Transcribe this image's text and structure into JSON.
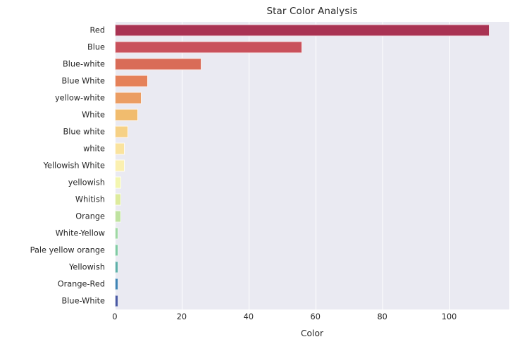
{
  "chart_data": {
    "type": "bar",
    "orientation": "horizontal",
    "title": "Star Color Analysis",
    "xlabel": "Color",
    "ylabel": "",
    "categories": [
      "Red",
      "Blue",
      "Blue-white",
      "Blue White",
      "yellow-white",
      "White",
      "Blue white",
      "white",
      "Yellowish White",
      "yellowish",
      "Whitish",
      "Orange",
      "White-Yellow",
      "Pale yellow orange",
      "Yellowish",
      "Orange-Red",
      "Blue-White"
    ],
    "values": [
      112,
      56,
      26,
      10,
      8,
      7,
      4,
      3,
      3,
      2,
      2,
      2,
      1,
      1,
      1,
      1,
      1
    ],
    "bar_colors": [
      "#a93353",
      "#c9515c",
      "#d96c58",
      "#e58159",
      "#eb9d63",
      "#f1bc6e",
      "#f6d186",
      "#fae39e",
      "#fbf0b0",
      "#f3f6b0",
      "#ddeb9d",
      "#bfe2a0",
      "#9fd8a4",
      "#81cba4",
      "#5fb0a9",
      "#4084b5",
      "#4a5aa4"
    ],
    "xticks": [
      0,
      20,
      40,
      60,
      80,
      100
    ],
    "xlim": [
      0,
      118
    ],
    "gridlines": true,
    "grid_color": "#ffffff",
    "plot_background": "#eaeaf2",
    "figure_background": "#ffffff",
    "text_color": "#262626"
  }
}
